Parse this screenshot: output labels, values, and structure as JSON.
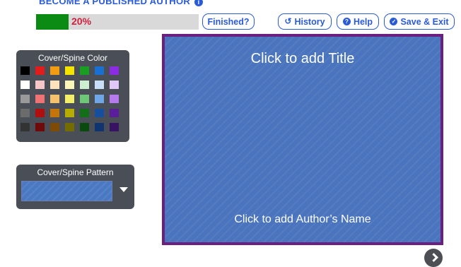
{
  "header": {
    "title": "BECOME A PUBLISHED AUTHOR",
    "info_glyph": "i"
  },
  "progress": {
    "value": 0.2,
    "label": "20%",
    "fill_color": "#0b8a14",
    "label_color": "#d2213e"
  },
  "toolbar": {
    "finished_label": "Finished?",
    "history_label": "History",
    "help_label": "Help",
    "save_exit_label": "Save & Exit"
  },
  "icons": {
    "history": "history-icon",
    "help": "help-icon",
    "save_exit": "check-circle-icon",
    "next": "chevron-right-icon",
    "dropdown": "caret-down-icon"
  },
  "color_panel": {
    "title": "Cover/Spine Color",
    "swatches": [
      "#000000",
      "#e21b1b",
      "#f39c12",
      "#f4e400",
      "#1a9e22",
      "#1a6fd2",
      "#8b2be2",
      "#ffffff",
      "#f7c6c6",
      "#fbe3bd",
      "#fbf7b8",
      "#cdeecf",
      "#c9def8",
      "#e1c9f7",
      "#9a9a9a",
      "#ef7373",
      "#f5c16c",
      "#f5ee6a",
      "#6dc776",
      "#6ea6e8",
      "#b679ee",
      "#6c6c6c",
      "#b10f0f",
      "#c47408",
      "#b7ad00",
      "#126f17",
      "#174fa0",
      "#5c1d9b",
      "#333333",
      "#6e0a0a",
      "#7e4a05",
      "#736c00",
      "#0b4a0e",
      "#0f3470",
      "#3a1263"
    ]
  },
  "pattern_panel": {
    "title": "Cover/Spine Pattern",
    "selected_color": "#4a78c2"
  },
  "cover": {
    "title_placeholder": "Click to add Title",
    "author_placeholder": "Click to add Author’s Name",
    "background_color": "#4a74bd",
    "border_color": "#6b1f7e"
  }
}
